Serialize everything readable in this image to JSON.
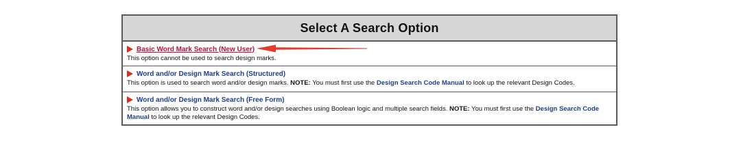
{
  "panel": {
    "title": "Select A Search Option"
  },
  "options": [
    {
      "link": "Basic Word Mark Search (New User)",
      "description": "This option cannot be used to search design marks."
    },
    {
      "link": "Word and/or Design Mark Search (Structured)",
      "desc_before": "This option is used to search word and/or design marks.",
      "note_label": "NOTE:",
      "desc_mid": "You must first use the",
      "manual_link": "Design Search Code Manual",
      "desc_after": "to look up the relevant Design Codes."
    },
    {
      "link": "Word and/or Design Mark Search (Free Form)",
      "desc_before": "This option allows you to construct word and/or design searches using Boolean logic and multiple search fields.",
      "note_label": "NOTE:",
      "desc_mid": "You must first use the",
      "manual_link": "Design Search Code Manual",
      "desc_after": "to look up the relevant Design Codes."
    }
  ],
  "colors": {
    "bullet": "#e02a1c",
    "visited_link": "#b5113a",
    "link": "#1d3f86",
    "annotation_arrow": "#e53a2e"
  },
  "icons": {
    "bullet": "play-triangle-icon",
    "annotation": "pointing-arrow-icon"
  }
}
